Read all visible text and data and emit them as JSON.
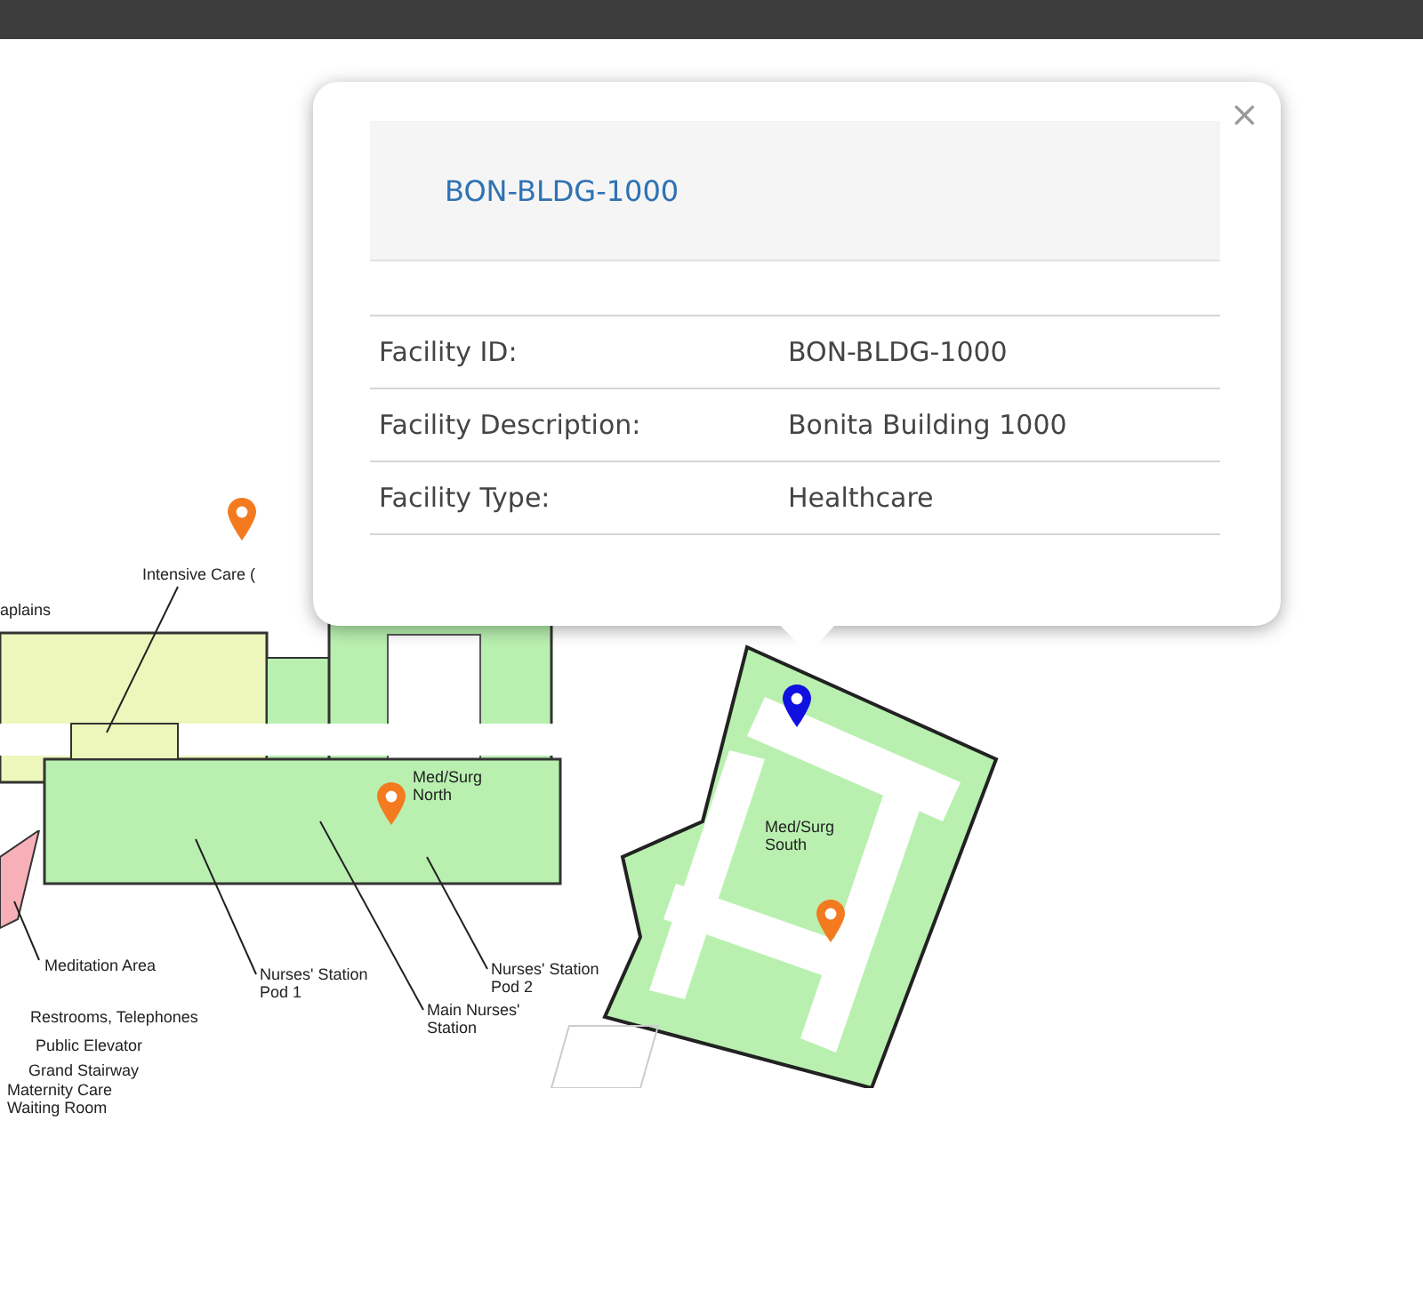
{
  "map": {
    "labels": [
      {
        "text": "Intensive Care ("
      },
      {
        "text": "aplains"
      },
      {
        "text": "Med/Surg North"
      },
      {
        "text": "Med/Surg South"
      },
      {
        "text": "Meditation Area"
      },
      {
        "text": "Restrooms, Telephones"
      },
      {
        "text": "Public Elevator"
      },
      {
        "text": "Grand Stairway"
      },
      {
        "text": "Maternity Care Waiting Room"
      },
      {
        "text": "Nurses' Station Pod 1"
      },
      {
        "text": "Main Nurses' Station"
      },
      {
        "text": "Nurses' Station Pod 2"
      }
    ],
    "markers": [
      {
        "color": "#f47a1f"
      },
      {
        "color": "#f47a1f"
      },
      {
        "color": "#1010e0"
      },
      {
        "color": "#f47a1f"
      }
    ]
  },
  "popup": {
    "title": "BON-BLDG-1000",
    "close": "×",
    "rows": [
      {
        "label": "Facility ID:",
        "value": "BON-BLDG-1000"
      },
      {
        "label": "Facility Description:",
        "value": "Bonita Building 1000"
      },
      {
        "label": "Facility Type:",
        "value": "Healthcare"
      }
    ]
  }
}
